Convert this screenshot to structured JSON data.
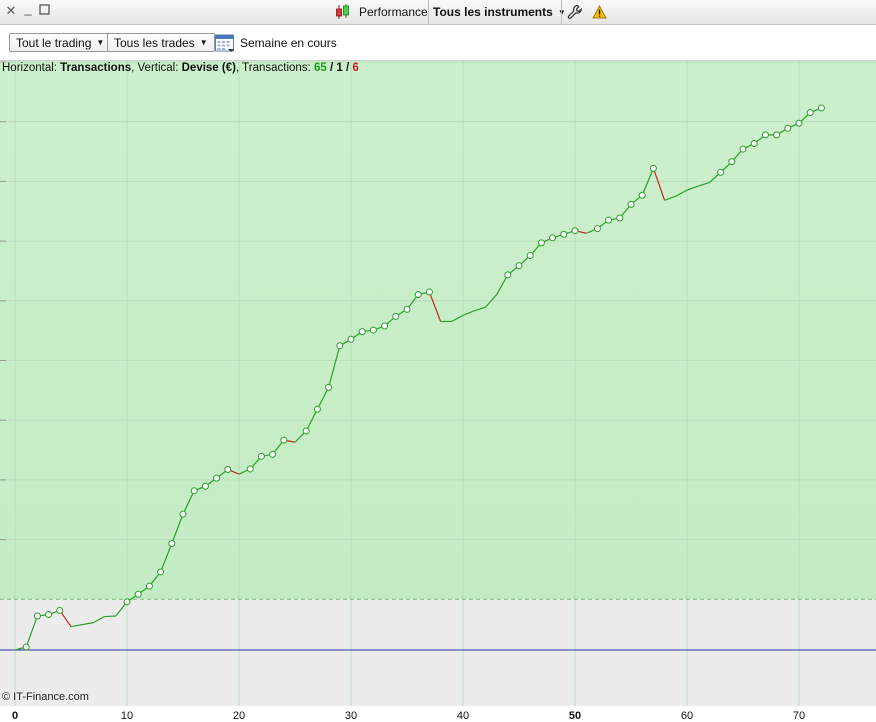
{
  "titlebar": {
    "performance_label": "Performance",
    "instruments_label": "Tous les instruments",
    "window_controls": [
      "close-icon",
      "minimize-icon",
      "maximize-icon"
    ],
    "icons": [
      "candlestick-icon",
      "wrench-icon",
      "warning-icon"
    ]
  },
  "toolbar": {
    "trading_filter": "Tout le trading",
    "trades_filter": "Tous les trades",
    "period_label": "Semaine en cours"
  },
  "info": {
    "horizontal_prefix": "Horizontal: ",
    "horizontal_value": "Transactions",
    "vertical_prefix": ", Vertical: ",
    "vertical_value": "Devise (€)",
    "transactions_prefix": ", Transactions: ",
    "count_total": "65",
    "slash1": " / ",
    "count_neutral": "1",
    "slash2": " / ",
    "count_losing": "6"
  },
  "footer": {
    "copyright": "© IT-Finance.com"
  },
  "colors": {
    "profit_zone": "#c4ecc4",
    "loss_zone": "#ececec",
    "winning_line": "#2aa12a",
    "losing_line": "#c42323",
    "baseline": "#2b2bb0",
    "marker_fill": "#ffffff"
  },
  "chart_data": {
    "type": "line",
    "title": "",
    "xlabel": "Transactions",
    "ylabel": "Devise (€)",
    "x_ticks": [
      "0",
      "10",
      "20",
      "30",
      "40",
      "50",
      "60",
      "70"
    ],
    "xlim": [
      0,
      77
    ],
    "ylim": [
      -0.45,
      1.0
    ],
    "y_unit": "relative equity (y axis unlabeled)",
    "x": [
      0,
      1,
      2,
      3,
      4,
      5,
      6,
      7,
      8,
      9,
      10,
      11,
      12,
      13,
      14,
      15,
      16,
      17,
      18,
      19,
      20,
      21,
      22,
      23,
      24,
      25,
      26,
      27,
      28,
      29,
      30,
      31,
      32,
      33,
      34,
      35,
      36,
      37,
      38,
      39,
      40,
      41,
      42,
      43,
      44,
      45,
      46,
      47,
      48,
      49,
      50,
      51,
      52,
      53,
      54,
      55,
      56,
      57,
      58,
      59,
      60,
      61,
      62,
      63,
      64,
      65,
      66,
      67,
      68,
      69,
      70,
      71,
      72
    ],
    "y": [
      0.0,
      0.006,
      0.067,
      0.07,
      0.078,
      0.046,
      0.05,
      0.054,
      0.066,
      0.067,
      0.095,
      0.11,
      0.126,
      0.154,
      0.21,
      0.268,
      0.314,
      0.323,
      0.339,
      0.356,
      0.347,
      0.357,
      0.382,
      0.386,
      0.414,
      0.41,
      0.432,
      0.475,
      0.518,
      0.6,
      0.613,
      0.628,
      0.631,
      0.639,
      0.658,
      0.672,
      0.701,
      0.706,
      0.648,
      0.648,
      0.66,
      0.669,
      0.676,
      0.701,
      0.74,
      0.758,
      0.778,
      0.803,
      0.813,
      0.82,
      0.827,
      0.822,
      0.831,
      0.848,
      0.852,
      0.879,
      0.897,
      0.95,
      0.887,
      0.895,
      0.907,
      0.915,
      0.922,
      0.942,
      0.963,
      0.988,
      0.999,
      1.016,
      1.016,
      1.029,
      1.039,
      1.06,
      1.069
    ],
    "markers_on_points": [
      1,
      2,
      3,
      4,
      10,
      11,
      12,
      13,
      14,
      15,
      16,
      17,
      18,
      19,
      21,
      22,
      23,
      24,
      26,
      27,
      28,
      29,
      30,
      31,
      32,
      33,
      34,
      35,
      36,
      37,
      44,
      45,
      46,
      47,
      48,
      49,
      50,
      52,
      53,
      54,
      55,
      56,
      57,
      63,
      64,
      65,
      66,
      67,
      68,
      69,
      70,
      71,
      72
    ],
    "losing_segments": [
      [
        4,
        5
      ],
      [
        19,
        20
      ],
      [
        24,
        25
      ],
      [
        37,
        38
      ],
      [
        50,
        51
      ],
      [
        57,
        58
      ]
    ],
    "profit_threshold": 0.1,
    "baseline": 0.0
  }
}
